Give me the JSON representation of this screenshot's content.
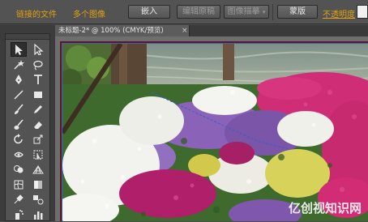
{
  "control_bar": {
    "link_file": "链接的文件",
    "multi_images": "多个图像",
    "embed": "嵌入",
    "edit_original": "编辑原稿",
    "image_trace": "图像描摹",
    "mask": "蒙版",
    "opacity_label": "不透明度"
  },
  "document_tab": {
    "title": "未标题-2* @ 100% (CMYK/预览)",
    "close": "×"
  },
  "watermark": "亿创视知识网",
  "tools": [
    "selection-tool-icon",
    "direct-selection-tool-icon",
    "magic-wand-tool-icon",
    "lasso-tool-icon",
    "pen-tool-icon",
    "type-tool-icon",
    "line-tool-icon",
    "rectangle-tool-icon",
    "paintbrush-tool-icon",
    "pencil-tool-icon",
    "blob-brush-tool-icon",
    "eraser-tool-icon",
    "rotate-tool-icon",
    "scale-tool-icon",
    "width-tool-icon",
    "free-transform-tool-icon",
    "shape-builder-tool-icon",
    "perspective-grid-tool-icon",
    "mesh-tool-icon",
    "gradient-tool-icon",
    "eyedropper-tool-icon",
    "blend-tool-icon",
    "symbol-sprayer-tool-icon",
    "column-graph-tool-icon"
  ],
  "colors": {
    "link_orange": "#e0a010",
    "selection_blue": "#3b5ec8"
  }
}
